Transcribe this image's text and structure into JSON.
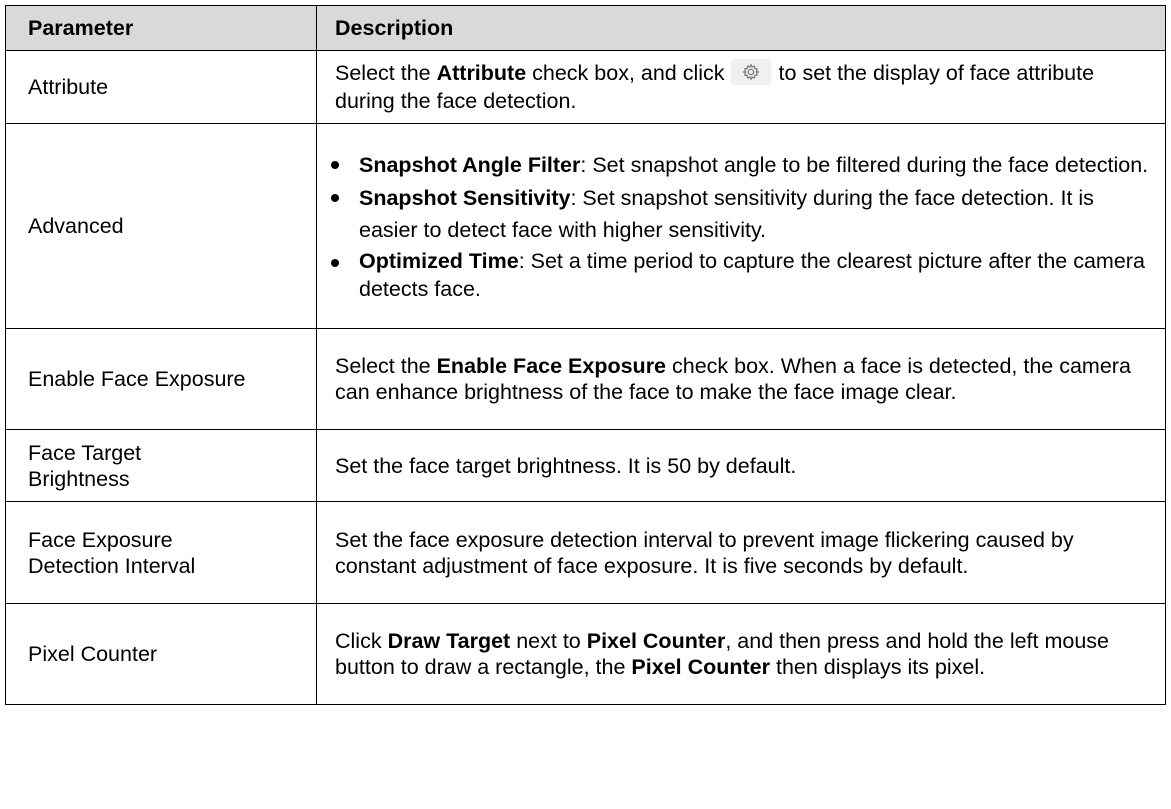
{
  "table": {
    "headers": [
      "Parameter",
      "Description"
    ],
    "rows": {
      "attribute": {
        "param": "Attribute",
        "t1": "Select the ",
        "b1": "Attribute",
        "t2": " check box, and click",
        "t3": "to set the display of face attribute during the face detection.",
        "icon": "settings-gear-icon"
      },
      "advanced": {
        "param": "Advanced",
        "bullets": [
          {
            "bold": "Snapshot Angle Filter",
            "text": ": Set snapshot angle to be filtered during the face detection."
          },
          {
            "bold": "Snapshot Sensitivity",
            "text": ": Set snapshot sensitivity during the face detection. It is easier to detect face with higher sensitivity."
          },
          {
            "bold": "Optimized Time",
            "text": ": Set a time period to capture the clearest picture after the camera detects face."
          }
        ]
      },
      "face_exposure": {
        "param": "Enable Face Exposure",
        "t1": "Select the ",
        "b1": "Enable Face Exposure",
        "t2": " check box. When a face is detected, the camera can enhance brightness of the face to make the face image clear."
      },
      "target_brightness": {
        "param": "Face Target Brightness",
        "text": "Set the face target brightness. It is 50 by default."
      },
      "detection_interval": {
        "param": "Face Exposure Detection Interval",
        "text": "Set the face exposure detection interval to prevent image flickering caused by constant adjustment of face exposure. It is five seconds by default."
      },
      "pixel_counter": {
        "param": "Pixel Counter",
        "t1": "Click ",
        "b1": "Draw Target",
        "t2": " next to ",
        "b2": "Pixel Counter",
        "t3": ", and then press and hold the left mouse button to draw a rectangle, the ",
        "b3": "Pixel Counter",
        "t4": " then displays its pixel."
      }
    }
  },
  "colors": {
    "header_bg": "#d9d9d9",
    "border": "#000000",
    "icon": "#7a7a7a"
  }
}
